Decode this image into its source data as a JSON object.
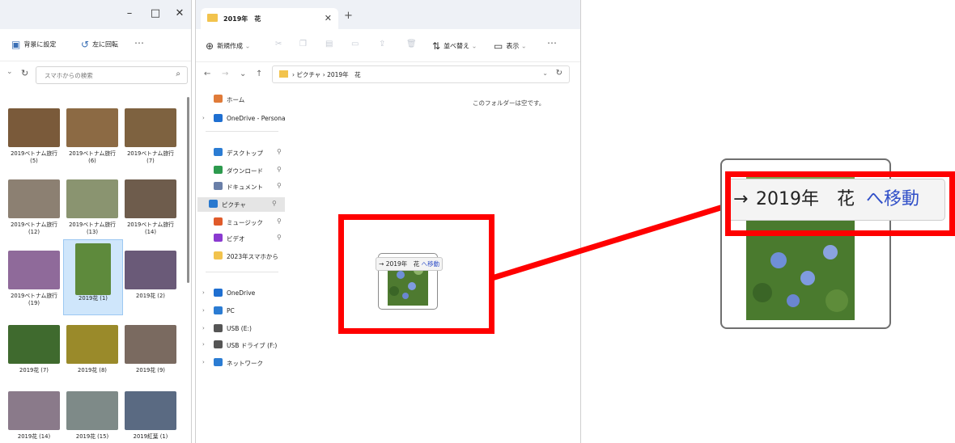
{
  "left_window": {
    "caption_buttons": [
      "–",
      "□",
      "✕"
    ],
    "commands": [
      {
        "icon": "wallpaper-icon",
        "label": "背景に設定"
      },
      {
        "icon": "rotate-left-icon",
        "label": "左に回転"
      },
      {
        "icon": "more-icon",
        "label": "･･･"
      }
    ],
    "search": {
      "placeholder": "スマホからの検索"
    },
    "thumbnails": [
      {
        "caption": "2019ベトナム旅行\n(5)",
        "color": "#7a5a3a"
      },
      {
        "caption": "2019ベトナム旅行\n(6)",
        "color": "#8c6a44"
      },
      {
        "caption": "2019ベトナム旅行\n(7)",
        "color": "#7e6240"
      },
      {
        "caption": "2019ベトナム旅行\n(12)",
        "color": "#8c8072"
      },
      {
        "caption": "2019ベトナム旅行\n(13)",
        "color": "#8a9470"
      },
      {
        "caption": "2019ベトナム旅行\n(14)",
        "color": "#6e5c4c"
      },
      {
        "caption": "2019ベトナム旅行\n(19)",
        "color": "#8f6a9a"
      },
      {
        "caption": "2019花 (1)",
        "color": "#5e8a3c",
        "selected": true
      },
      {
        "caption": "2019花 (2)",
        "color": "#6a5a78"
      },
      {
        "caption": "2019花 (7)",
        "color": "#3f6a2e"
      },
      {
        "caption": "2019花 (8)",
        "color": "#9a8a2a"
      },
      {
        "caption": "2019花 (9)",
        "color": "#7a6a60"
      },
      {
        "caption": "2019花 (14)",
        "color": "#8a7a8a"
      },
      {
        "caption": "2019花 (15)",
        "color": "#7e8a88"
      },
      {
        "caption": "2019紅葉 (1)",
        "color": "#5a6a82"
      }
    ]
  },
  "right_window": {
    "tab": {
      "title": "2019年　花"
    },
    "new_tab": "+",
    "commands": {
      "new": "新規作成",
      "sort": "並べ替え",
      "view": "表示",
      "more": "･･･"
    },
    "breadcrumb": "› ピクチャ › 2019年　花",
    "nav_items": [
      {
        "label": "ホーム",
        "icon": "home-icon",
        "color": "#e07b39",
        "chevron": ""
      },
      {
        "label": "OneDrive - Persona",
        "icon": "cloud-icon",
        "color": "#1f6fd1",
        "chevron": "›"
      },
      {
        "label": "デスクトップ",
        "icon": "desktop-icon",
        "color": "#2b7cd3",
        "chevron": "",
        "pin": true
      },
      {
        "label": "ダウンロード",
        "icon": "download-icon",
        "color": "#2d9a4e",
        "chevron": "",
        "pin": true
      },
      {
        "label": "ドキュメント",
        "icon": "document-icon",
        "color": "#6a7fa8",
        "chevron": "",
        "pin": true
      },
      {
        "label": "ピクチャ",
        "icon": "pictures-icon",
        "color": "#2a79cf",
        "chevron": "",
        "pin": true,
        "active": true
      },
      {
        "label": "ミュージック",
        "icon": "music-icon",
        "color": "#e05a2a",
        "chevron": "",
        "pin": true
      },
      {
        "label": "ビデオ",
        "icon": "video-icon",
        "color": "#8a3ad0",
        "chevron": "",
        "pin": true
      },
      {
        "label": "2023年スマホから",
        "icon": "folder-icon",
        "color": "#f2c34d",
        "chevron": ""
      },
      {
        "label": "OneDrive",
        "icon": "cloud-icon",
        "color": "#1f6fd1",
        "chevron": "›"
      },
      {
        "label": "PC",
        "icon": "pc-icon",
        "color": "#2b7cd3",
        "chevron": "›"
      },
      {
        "label": "USB (E:)",
        "icon": "drive-icon",
        "color": "#555555",
        "chevron": "›"
      },
      {
        "label": "USB ドライブ (F:)",
        "icon": "drive-icon",
        "color": "#555555",
        "chevron": "›"
      },
      {
        "label": "ネットワーク",
        "icon": "network-icon",
        "color": "#2b7cd3",
        "chevron": "›"
      }
    ],
    "empty_message": "このフォルダーは空です。",
    "drag_tooltip": {
      "arrow": "→",
      "name": "2019年　花",
      "action": "へ移動"
    }
  },
  "zoom_callout": {
    "arrow": "→",
    "name": "2019年　花",
    "action": "へ移動"
  },
  "colors": {
    "highlight": "#ff0000",
    "move_text": "#3150c8",
    "selection": "#cfe6fb"
  }
}
